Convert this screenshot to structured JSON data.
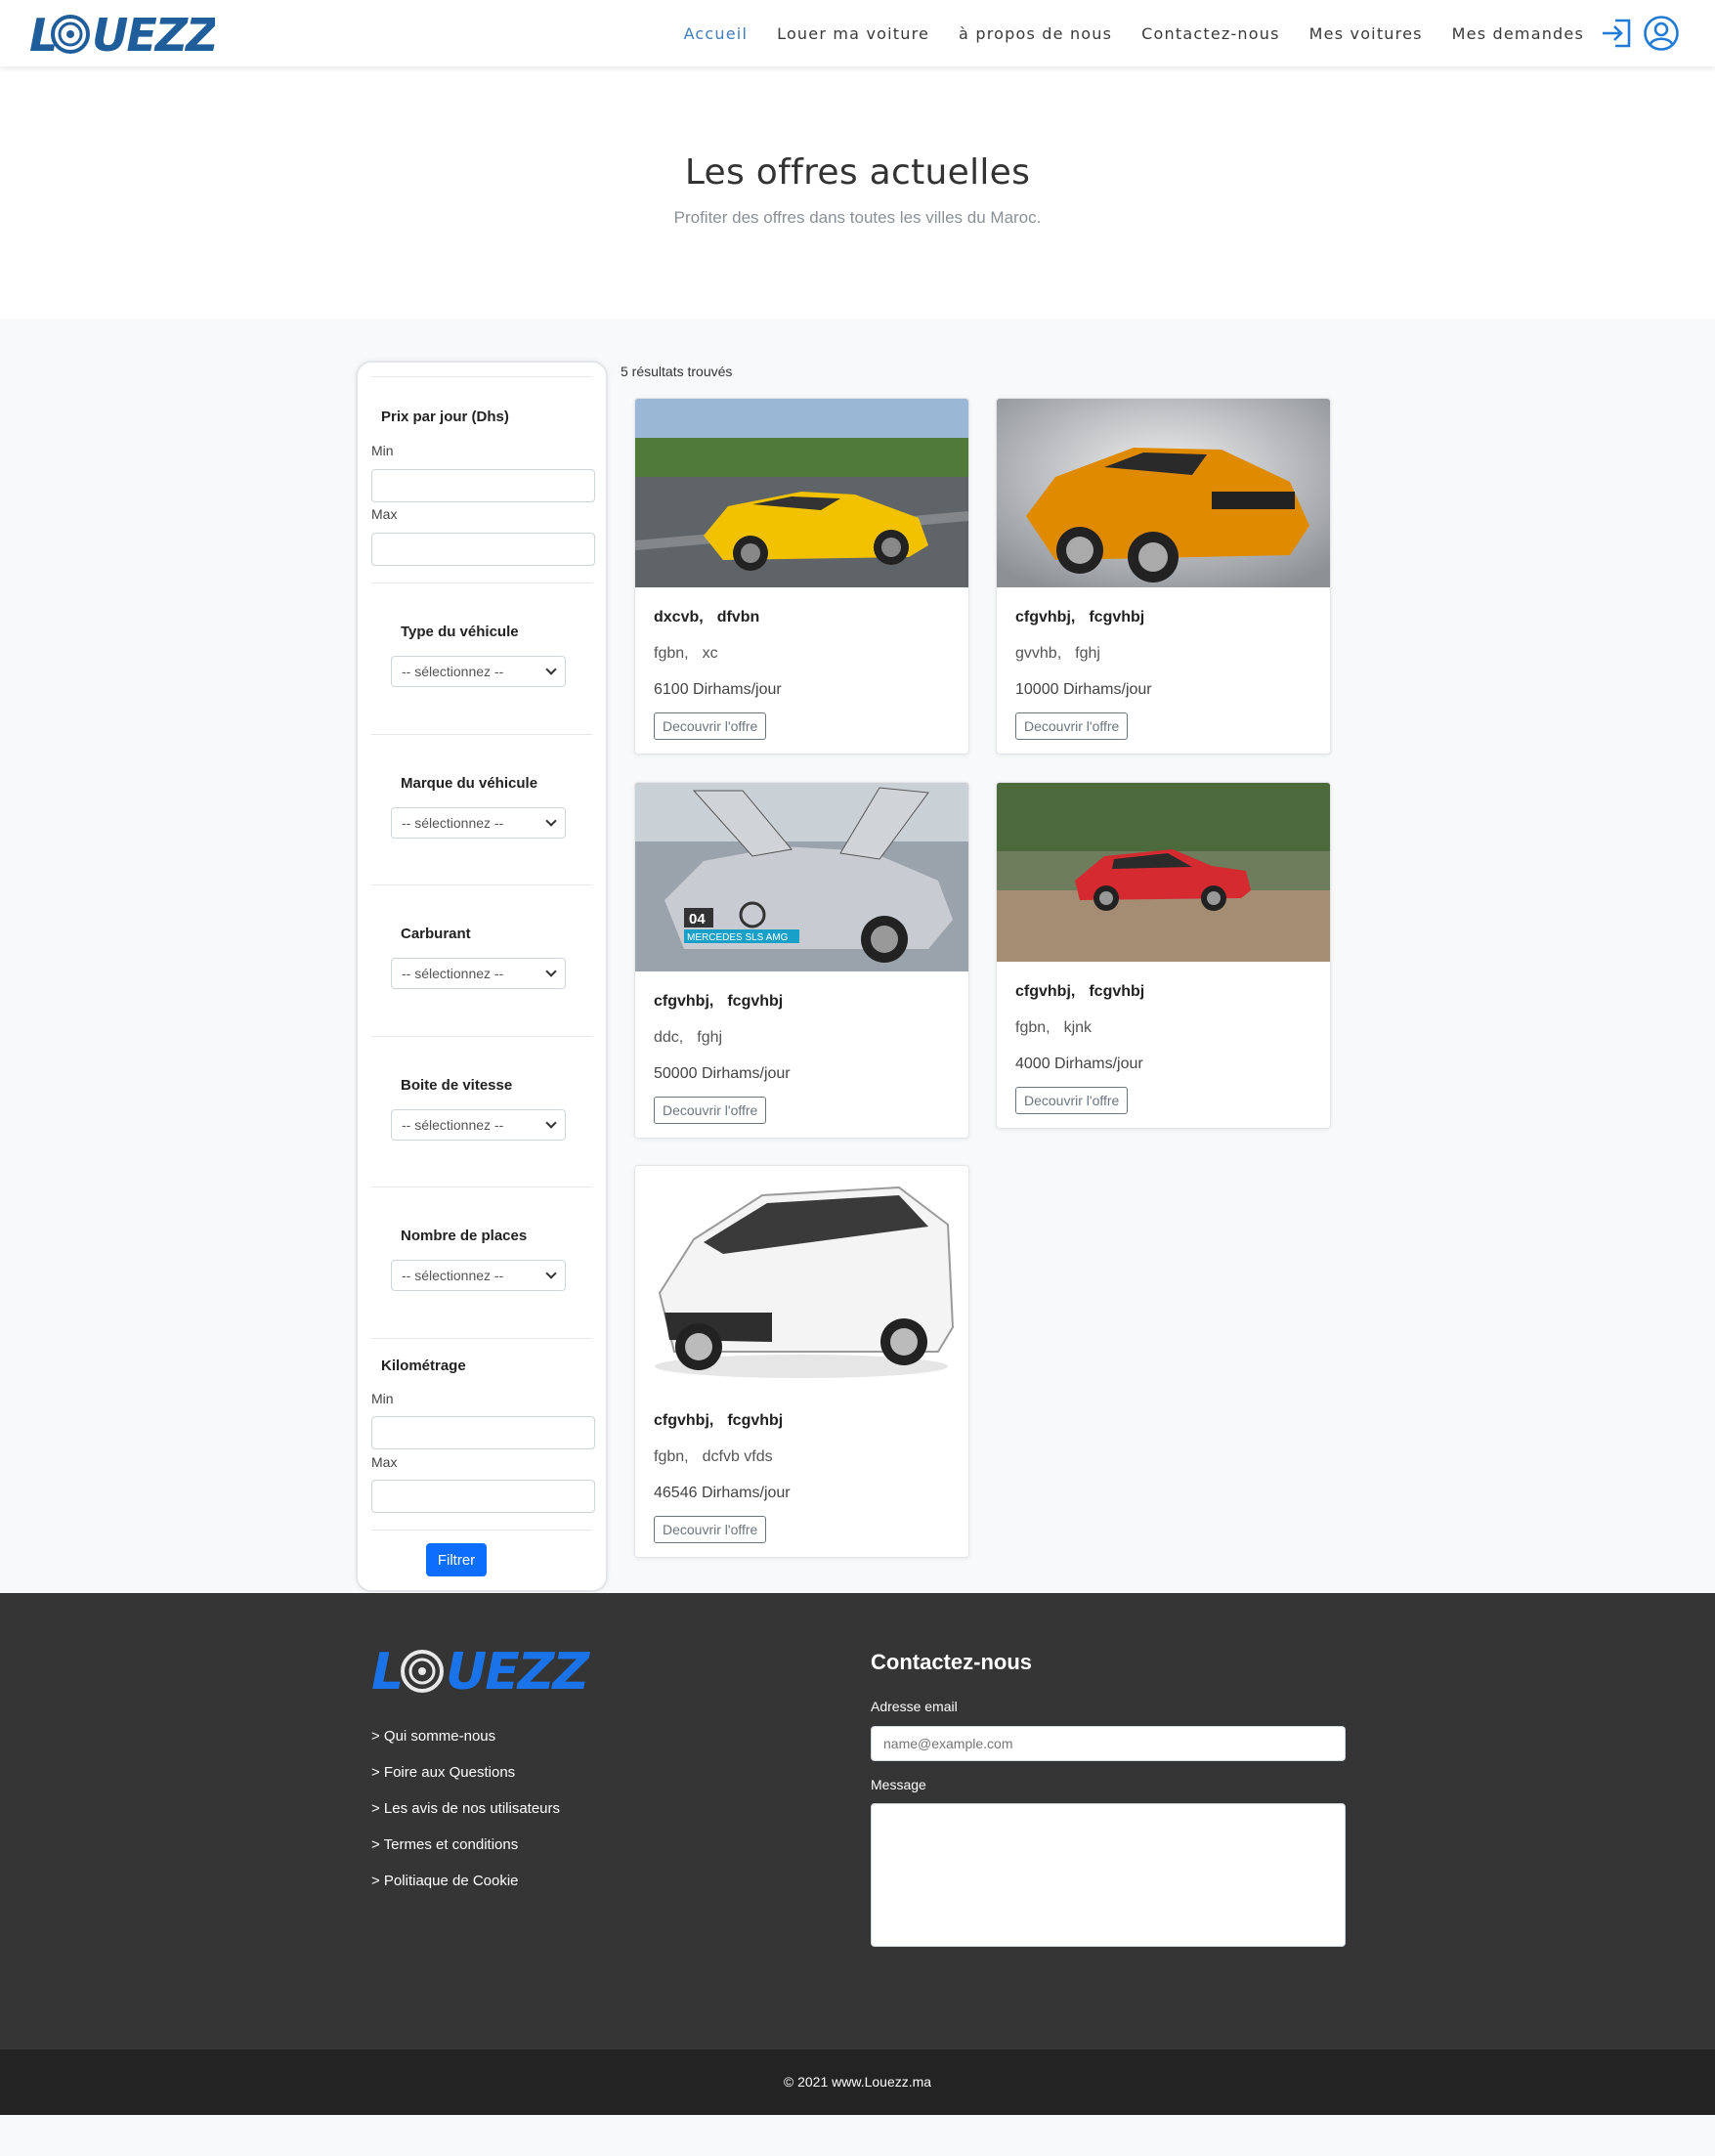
{
  "brand": {
    "logo_text": "LOUEZZ",
    "color": "#1f5e9b",
    "footer_color": "#1a73e8"
  },
  "nav": {
    "items": [
      {
        "label": "Accueil",
        "active": true
      },
      {
        "label": "Louer ma voiture"
      },
      {
        "label": "à propos de nous"
      },
      {
        "label": "Contactez-nous"
      },
      {
        "label": "Mes voitures"
      },
      {
        "label": "Mes demandes"
      }
    ],
    "icons": [
      "login-icon",
      "user-account-icon"
    ]
  },
  "hero": {
    "title": "Les offres actuelles",
    "subtitle": "Profiter des offres dans toutes les villes du Maroc."
  },
  "filters": {
    "price": {
      "title": "Prix par jour (Dhs)",
      "min_label": "Min",
      "max_label": "Max"
    },
    "type": {
      "title": "Type du véhicule",
      "selected": "-- sélectionnez --"
    },
    "brand": {
      "title": "Marque du véhicule",
      "selected": "-- sélectionnez --"
    },
    "fuel": {
      "title": "Carburant",
      "selected": "-- sélectionnez --"
    },
    "gearbox": {
      "title": "Boite de vitesse",
      "selected": "-- sélectionnez --"
    },
    "seats": {
      "title": "Nombre de places",
      "selected": "-- sélectionnez --"
    },
    "mileage": {
      "title": "Kilométrage",
      "min_label": "Min",
      "max_label": "Max"
    },
    "submit_label": "Filtrer"
  },
  "results": {
    "count_text": "5 résultats trouvés",
    "offers": [
      {
        "a": "dxcvb,",
        "b": "dfvbn",
        "c": "fgbn,",
        "d": "xc",
        "price": "6100 Dirhams/jour",
        "cta": "Decouvrir l'offre",
        "image": "yellow sports car",
        "car_color": "#f2c200"
      },
      {
        "a": "cfgvhbj,",
        "b": "fcgvhbj",
        "c": "gvvhb,",
        "d": "fghj",
        "price": "10000 Dirhams/jour",
        "cta": "Decouvrir l'offre",
        "image": "orange muscle car",
        "car_color": "#e08a00"
      },
      {
        "a": "cfgvhbj,",
        "b": "fcgvhbj",
        "c": "ddc,",
        "d": "fghj",
        "price": "50000 Dirhams/jour",
        "cta": "Decouvrir l'offre",
        "image": "silver gullwing car",
        "car_color": "#c8ccd2",
        "plate": "04",
        "plate_text": "MERCEDES SLS AMG"
      },
      {
        "a": "cfgvhbj,",
        "b": "fcgvhbj",
        "c": "fgbn,",
        "d": "kjnk",
        "price": "4000 Dirhams/jour",
        "cta": "Decouvrir l'offre",
        "image": "red hatchback",
        "car_color": "#d42a30"
      },
      {
        "a": "cfgvhbj,",
        "b": "fcgvhbj",
        "c": "fgbn,",
        "d": "dcfvb vfds",
        "price": "46546 Dirhams/jour",
        "cta": "Decouvrir l'offre",
        "image": "white minivan",
        "car_color": "#f4f4f4"
      }
    ]
  },
  "footer": {
    "links": [
      "> Qui somme-nous",
      "> Foire aux Questions",
      "> Les avis de nos utilisateurs",
      "> Termes et conditions",
      "> Politiaque de Cookie"
    ],
    "contact_title": "Contactez-nous",
    "email_label": "Adresse email",
    "email_placeholder": "name@example.com",
    "message_label": "Message",
    "copyright": "© 2021 www.Louezz.ma"
  }
}
